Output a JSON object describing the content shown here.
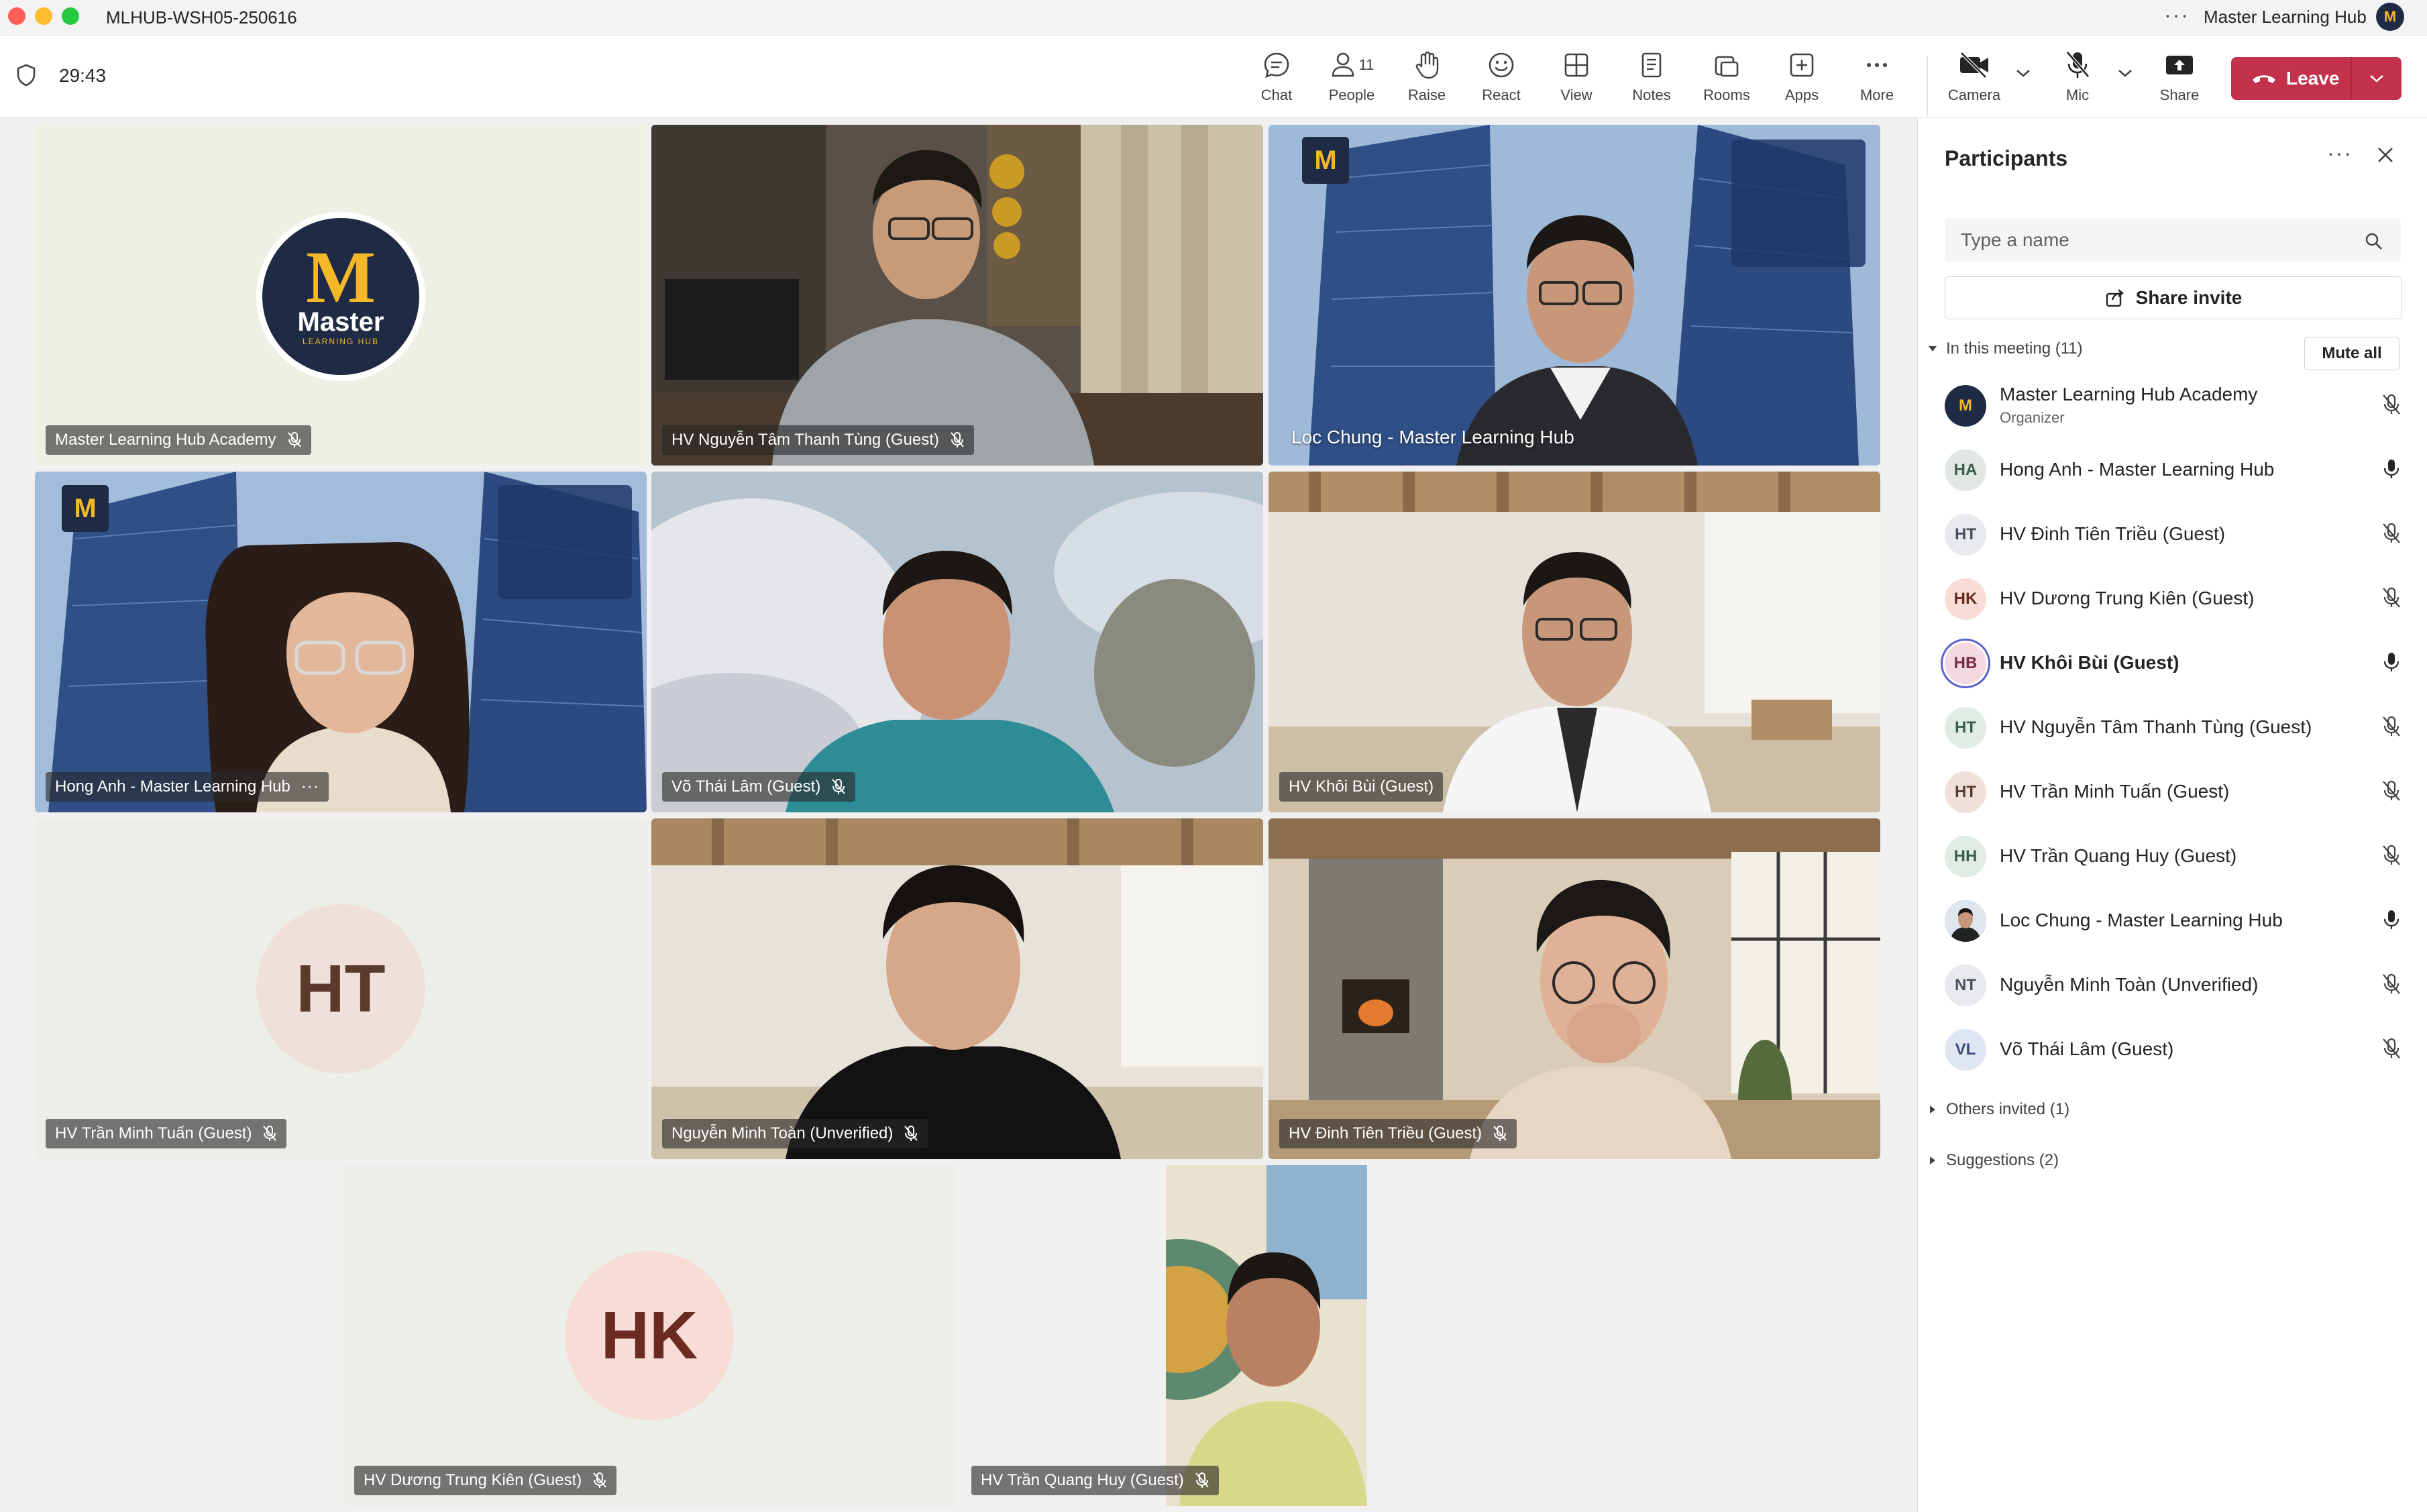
{
  "window": {
    "title": "MLHUB-WSH05-250616",
    "org": "Master Learning Hub",
    "org_avatar": "M"
  },
  "toolbar": {
    "timer": "29:43",
    "buttons": {
      "chat": "Chat",
      "people": "People",
      "people_count": "11",
      "raise": "Raise",
      "react": "React",
      "view": "View",
      "notes": "Notes",
      "rooms": "Rooms",
      "apps": "Apps",
      "more": "More",
      "camera": "Camera",
      "mic": "Mic",
      "share": "Share"
    },
    "leave": "Leave",
    "leave_color": "#c4314b",
    "accent_color": "#5b5fc7"
  },
  "tiles": [
    {
      "name": "Master Learning Hub Academy",
      "logo_word": "Master",
      "logo_sub": "LEARNING HUB"
    },
    {
      "name": "HV Nguyễn Tâm Thanh Tùng (Guest)"
    },
    {
      "name": "Loc Chung - Master Learning Hub"
    },
    {
      "name": "Hong Anh - Master Learning Hub"
    },
    {
      "name": "Võ Thái Lâm (Guest)"
    },
    {
      "name": "HV Khôi Bùi (Guest)"
    },
    {
      "name": "HV Trần Minh Tuấn (Guest)",
      "initials": "HT"
    },
    {
      "name": "Nguyễn Minh Toàn (Unverified)"
    },
    {
      "name": "HV Đinh Tiên Triều (Guest)"
    },
    {
      "name": "HV Dương Trung Kiên (Guest)",
      "initials": "HK"
    },
    {
      "name": "HV Trần Quang Huy (Guest)"
    }
  ],
  "panel": {
    "title": "Participants",
    "search_placeholder": "Type a name",
    "share_invite": "Share invite",
    "in_meeting": "In this meeting (11)",
    "mute_all": "Mute all",
    "participants": [
      {
        "initials": "M",
        "name": "Master Learning Hub Academy",
        "role": "Organizer",
        "mic": "off"
      },
      {
        "initials": "HA",
        "name": "Hong Anh - Master Learning Hub",
        "mic": "on"
      },
      {
        "initials": "HT",
        "name": "HV Đinh Tiên Triều (Guest)",
        "mic": "off"
      },
      {
        "initials": "HK",
        "name": "HV Dương Trung Kiên (Guest)",
        "mic": "off"
      },
      {
        "initials": "HB",
        "name": "HV Khôi Bùi (Guest)",
        "mic": "on",
        "speaking": true
      },
      {
        "initials": "HT",
        "name": "HV Nguyễn Tâm Thanh Tùng (Guest)",
        "mic": "off"
      },
      {
        "initials": "HT",
        "name": "HV Trần Minh Tuấn (Guest)",
        "mic": "off"
      },
      {
        "initials": "HH",
        "name": "HV Trần Quang Huy (Guest)",
        "mic": "off"
      },
      {
        "initials": "",
        "name": "Loc Chung - Master Learning Hub",
        "mic": "on"
      },
      {
        "initials": "NT",
        "name": "Nguyễn Minh Toàn (Unverified)",
        "mic": "off"
      },
      {
        "initials": "VL",
        "name": "Võ Thái Lâm (Guest)",
        "mic": "off"
      }
    ],
    "others_invited": "Others invited (1)",
    "suggestions": "Suggestions (2)"
  }
}
